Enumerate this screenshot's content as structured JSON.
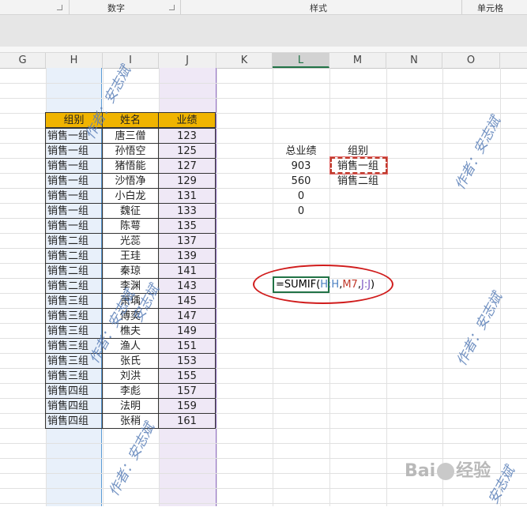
{
  "ribbon": {
    "group_number": "数字",
    "group_style": "样式",
    "group_cell": "单元格"
  },
  "columns": [
    "G",
    "H",
    "I",
    "J",
    "K",
    "L",
    "M",
    "N",
    "O"
  ],
  "selected_column": "L",
  "table": {
    "headers": [
      "组别",
      "姓名",
      "业绩"
    ],
    "rows": [
      [
        "销售一组",
        "唐三僧",
        "123"
      ],
      [
        "销售一组",
        "孙悟空",
        "125"
      ],
      [
        "销售一组",
        "猪悟能",
        "127"
      ],
      [
        "销售一组",
        "沙悟净",
        "129"
      ],
      [
        "销售一组",
        "小白龙",
        "131"
      ],
      [
        "销售一组",
        "魏征",
        "133"
      ],
      [
        "销售一组",
        "陈萼",
        "135"
      ],
      [
        "销售二组",
        "光蕊",
        "137"
      ],
      [
        "销售二组",
        "王珪",
        "139"
      ],
      [
        "销售二组",
        "秦琼",
        "141"
      ],
      [
        "销售二组",
        "李渊",
        "143"
      ],
      [
        "销售三组",
        "萧瑀",
        "145"
      ],
      [
        "销售三组",
        "傅奕",
        "147"
      ],
      [
        "销售三组",
        "樵夫",
        "149"
      ],
      [
        "销售三组",
        "渔人",
        "151"
      ],
      [
        "销售三组",
        "张氏",
        "153"
      ],
      [
        "销售三组",
        "刘洪",
        "155"
      ],
      [
        "销售四组",
        "李彪",
        "157"
      ],
      [
        "销售四组",
        "法明",
        "159"
      ],
      [
        "销售四组",
        "张稍",
        "161"
      ]
    ]
  },
  "summary": {
    "total_label": "总业绩",
    "group_label": "组别",
    "totals": [
      "903",
      "560",
      "0",
      "0"
    ],
    "groups": [
      "销售一组",
      "销售二组"
    ]
  },
  "formula": {
    "prefix": "=SUMIF(",
    "ref_h": "H:H",
    "comma1": ",",
    "ref_m": "M7",
    "comma2": ",",
    "ref_j": "J:J",
    "suffix": ")"
  },
  "watermarks": [
    "作者：安志斌",
    "作者：安志斌",
    "作者：安志斌",
    "作者：安志斌",
    "作者：安志斌",
    "安志斌",
    "安志斌"
  ],
  "baidu": {
    "left": "Bai",
    "right": "经验"
  }
}
